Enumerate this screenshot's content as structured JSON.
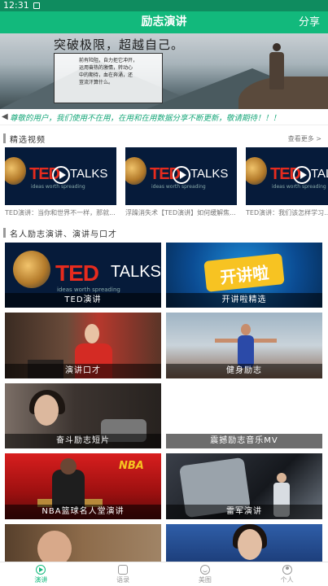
{
  "status_bar": {
    "time": "12:31"
  },
  "app_bar": {
    "title": "励志演讲",
    "share_label": "分享"
  },
  "banner": {
    "headline": "突破极限，超越自己。",
    "quote_lines": [
      "前有险阻，自力拒它冲开，",
      "运用奋热的激情，转动心",
      "中的期待，血在奔涌，还",
      "豈流汗算什么。"
    ]
  },
  "marquee": {
    "text": "尊敬的用户，我们使用不在用，在用和在用数据分享不断更新，敬请期待！！！"
  },
  "featured": {
    "title": "精选视频",
    "more_label": "查看更多 >",
    "videos": [
      {
        "caption": "TED演讲：当你和世界不一样，那就..."
      },
      {
        "caption": "浮躁消失术【TED演讲】如何缓解焦..."
      },
      {
        "caption": "TED演讲：我们该怎样学习..."
      }
    ]
  },
  "famous": {
    "title": "名人励志演讲、演讲与口才",
    "tiles": [
      {
        "caption": "TED演讲"
      },
      {
        "caption": "开讲啦精选"
      },
      {
        "caption": "演讲口才"
      },
      {
        "caption": "健身励志"
      },
      {
        "caption": "奋斗励志短片"
      },
      {
        "caption": "震撼励志音乐MV"
      },
      {
        "caption": "NBA篮球名人堂演讲"
      },
      {
        "caption": "雷军演讲"
      },
      {
        "caption": ""
      },
      {
        "caption": ""
      }
    ]
  },
  "thumb_text": {
    "ted": "TED",
    "talks": "TALKS",
    "sub": "ideas worth spreading",
    "nba_logo": "NBA",
    "kai_logo": "开讲啦"
  },
  "bottom_nav": [
    {
      "label": "演讲",
      "icon": "play-circle-icon",
      "active": true
    },
    {
      "label": "语录",
      "icon": "book-icon",
      "active": false
    },
    {
      "label": "美图",
      "icon": "smile-icon",
      "active": false
    },
    {
      "label": "个人",
      "icon": "user-icon",
      "active": false
    }
  ],
  "colors": {
    "accent": "#12b97c",
    "status_bar": "#0f8c5f"
  }
}
